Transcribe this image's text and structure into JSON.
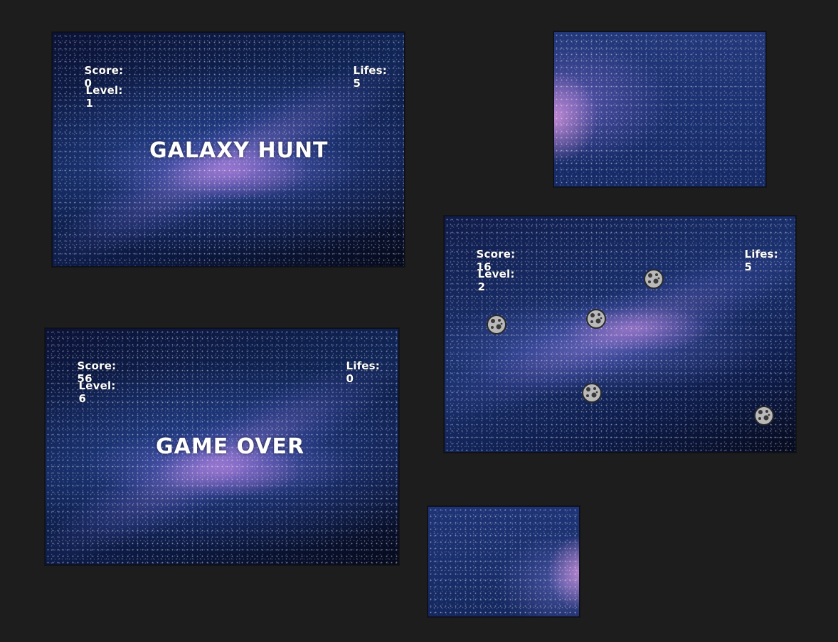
{
  "background_color": "#1d1d1d",
  "screens": {
    "title": {
      "score_label": "Score:",
      "score_value": "0",
      "level_label": "Level:",
      "level_value": "1",
      "lives_label": "Lifes:",
      "lives_value": "5",
      "heading": "GALAXY HUNT"
    },
    "gameplay": {
      "score_label": "Score:",
      "score_value": "16",
      "level_label": "Level:",
      "level_value": "2",
      "lives_label": "Lifes:",
      "lives_value": "5",
      "asteroid_count": 5,
      "asteroid_icon": "asteroid-icon"
    },
    "game_over": {
      "score_label": "Score:",
      "score_value": "56",
      "level_label": "Level:",
      "level_value": "6",
      "lives_label": "Lifes:",
      "lives_value": "0",
      "heading": "GAME OVER"
    }
  },
  "colors": {
    "hud_text": "#ffffff",
    "space_dark": "#070b1e",
    "nebula_purple": "#c88cdc",
    "asteroid_gray": "#b4b4b4"
  }
}
